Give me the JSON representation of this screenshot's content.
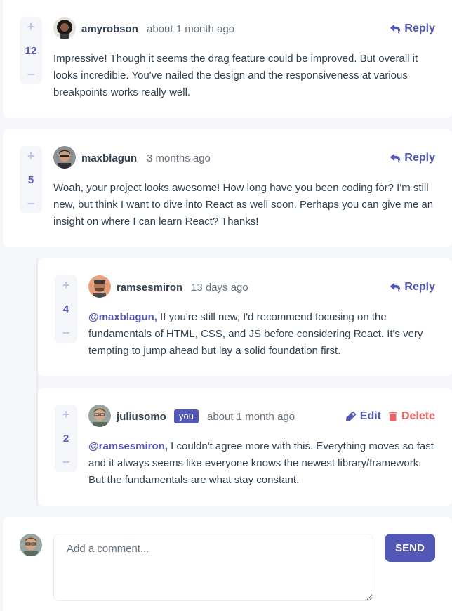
{
  "comments": [
    {
      "username": "amyrobson",
      "time": "about 1 month ago",
      "score": "12",
      "action": "Reply",
      "content": "Impressive! Though it seems the drag feature could be improved. But overall it looks incredible. You've nailed the design and the responsiveness at various breakpoints works really well."
    },
    {
      "username": "maxblagun",
      "time": "3 months ago",
      "score": "5",
      "action": "Reply",
      "content": "Woah, your project looks awesome! How long have you been coding for? I'm still new, but think I want to dive into React as well soon. Perhaps you can give me an insight on where I can learn React? Thanks!"
    }
  ],
  "replies": [
    {
      "username": "ramsesmiron",
      "time": "13 days ago",
      "score": "4",
      "action": "Reply",
      "mention": "@maxblagun,",
      "content": " If you're still new, I'd recommend focusing on the fundamentals of HTML, CSS, and JS before considering React. It's very tempting to jump ahead but lay a solid foundation first."
    },
    {
      "username": "juliusomo",
      "you_badge": "you",
      "time": "about 1 month ago",
      "score": "2",
      "edit": "Edit",
      "delete": "Delete",
      "mention": "@ramsesmiron,",
      "content": " I couldn't agree more with this. Everything moves so fast and it always seems like everyone knows the newest library/framework. But the fundamentals are what stay constant."
    }
  ],
  "vote": {
    "plus": "+",
    "minus": "−"
  },
  "composer": {
    "placeholder": "Add a comment...",
    "send": "SEND"
  },
  "colors": {
    "accent": "#5357b6",
    "danger": "#ed6368",
    "muted": "#c5c6ef",
    "bg": "#f5f6fa"
  }
}
